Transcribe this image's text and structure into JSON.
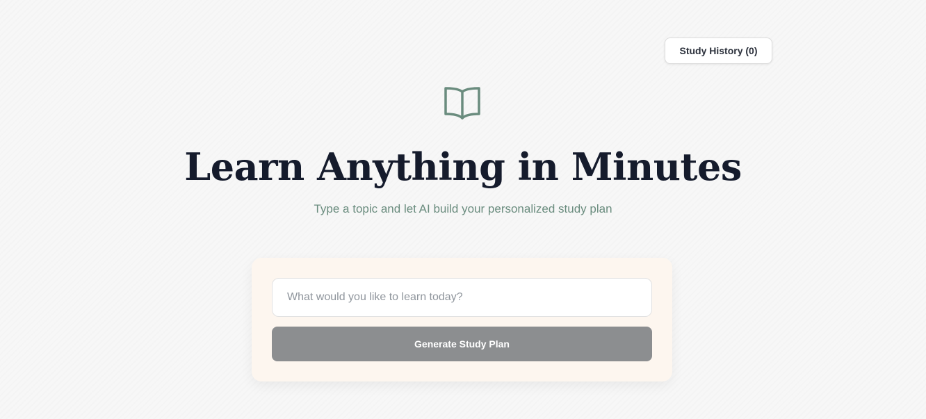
{
  "header": {
    "history_button_label": "Study History (0)"
  },
  "hero": {
    "icon": "book-open-icon",
    "title": "Learn Anything in Minutes",
    "subtitle": "Type a topic and let AI build your personalized study plan"
  },
  "form": {
    "topic_value": "",
    "topic_placeholder": "What would you like to learn today?",
    "generate_label": "Generate Study Plan"
  },
  "colors": {
    "accent_green": "#6a8c7e",
    "title_text": "#151b2c",
    "card_background": "#fdf6ef",
    "button_disabled": "#8c8e90"
  }
}
